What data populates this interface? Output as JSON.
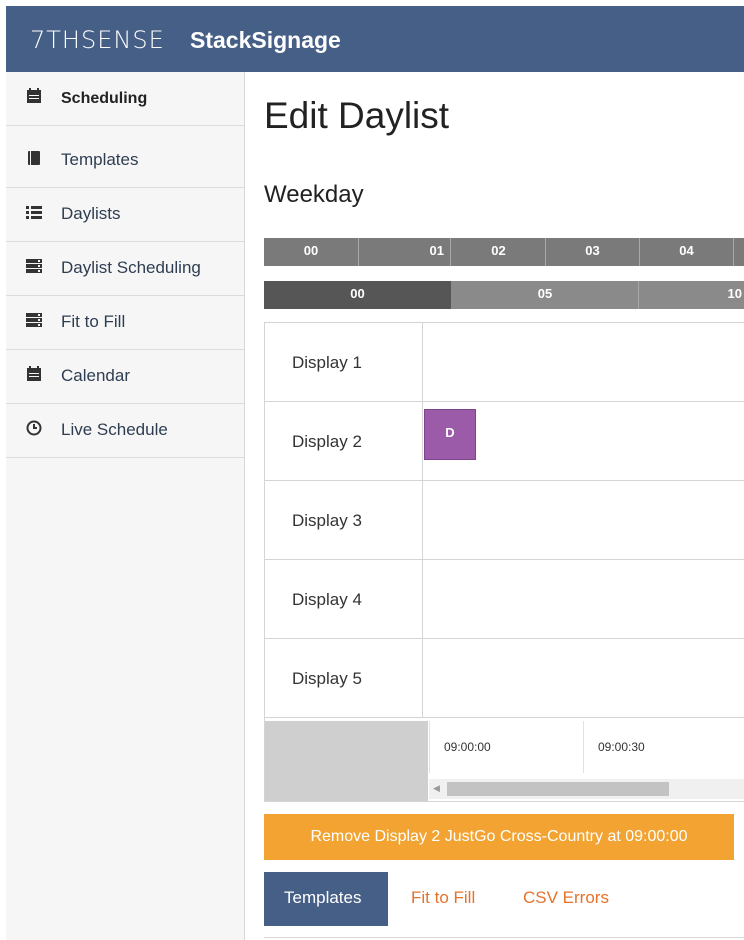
{
  "header": {
    "brand": "7THSENSE",
    "product": "StackSignage"
  },
  "sidebar": {
    "items": [
      {
        "label": "Scheduling",
        "icon": "calendar-icon",
        "active": true
      },
      {
        "label": "Templates",
        "icon": "book-icon"
      },
      {
        "label": "Daylists",
        "icon": "list-icon"
      },
      {
        "label": "Daylist Scheduling",
        "icon": "server-icon"
      },
      {
        "label": "Fit to Fill",
        "icon": "server-icon"
      },
      {
        "label": "Calendar",
        "icon": "calendar-icon"
      },
      {
        "label": "Live Schedule",
        "icon": "clock-icon"
      }
    ]
  },
  "page": {
    "title": "Edit Daylist",
    "subtitle": "Weekday"
  },
  "hour_ruler": [
    "00",
    "01",
    "02",
    "03",
    "04"
  ],
  "zoom_ruler": [
    "00",
    "05",
    "10"
  ],
  "displays": [
    {
      "name": "Display 1"
    },
    {
      "name": "Display 2",
      "item_label": "D"
    },
    {
      "name": "Display 3"
    },
    {
      "name": "Display 4"
    },
    {
      "name": "Display 5"
    }
  ],
  "timeline": {
    "ticks": [
      "09:00:00",
      "09:00:30"
    ]
  },
  "notice": {
    "text": "Remove Display 2 JustGo Cross-Country at 09:00:00",
    "color": "#f2a332"
  },
  "tabs": [
    {
      "label": "Templates",
      "active": true
    },
    {
      "label": "Fit to Fill"
    },
    {
      "label": "CSV Errors"
    }
  ],
  "colors": {
    "header": "#465f86",
    "accent": "#e5722c",
    "schedule_item": "#9b5ba8"
  }
}
